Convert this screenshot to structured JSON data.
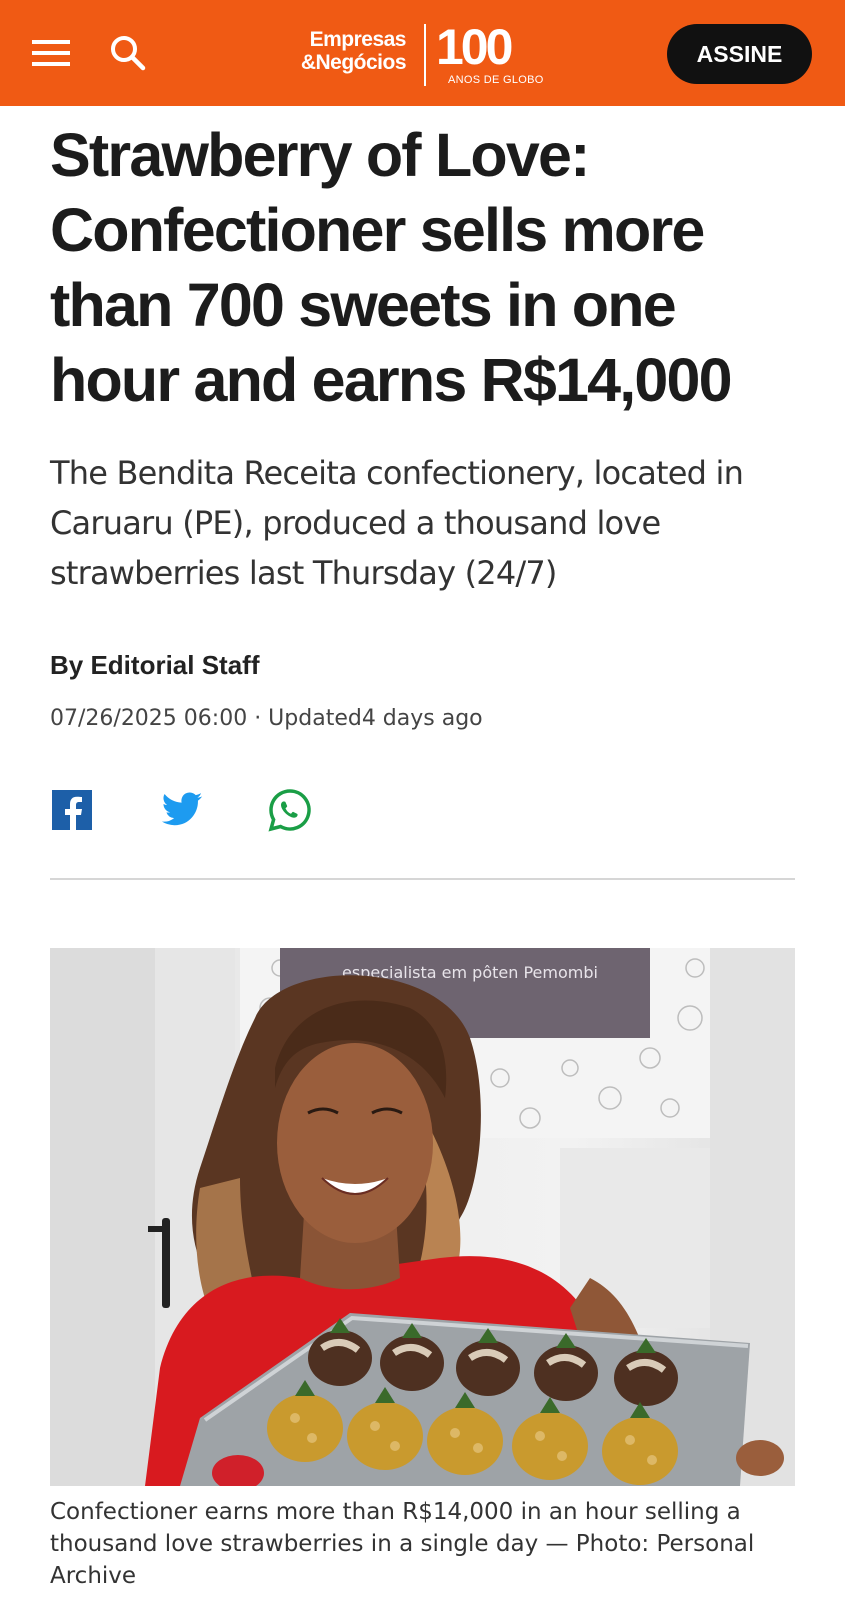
{
  "header": {
    "logo_line1": "Empresas",
    "logo_line2": "&Negócios",
    "logo_100": "100",
    "logo_sub": "ANOS DE GLOBO",
    "subscribe_label": "ASSINE",
    "bg_color": "#f05a14"
  },
  "article": {
    "headline": "Strawberry of Love: Confectioner sells more than 700 sweets in one hour and earns R$14,000",
    "subtitle": "The Bendita Receita confectionery, located in Caruaru (PE), produced a thousand love strawberries last Thursday (24/7)",
    "byline": "By Editorial Staff",
    "dateline": "07/26/2025 06:00 · Updated4 days ago",
    "share": {
      "facebook_icon": "facebook-icon",
      "twitter_icon": "twitter-icon",
      "whatsapp_icon": "whatsapp-icon"
    },
    "photo_sign_text": "especialista em pôten Pemombi",
    "caption": "Confectioner earns more than R$14,000 in an hour selling a thousand love strawberries in a single day — Photo: Personal Archive"
  }
}
